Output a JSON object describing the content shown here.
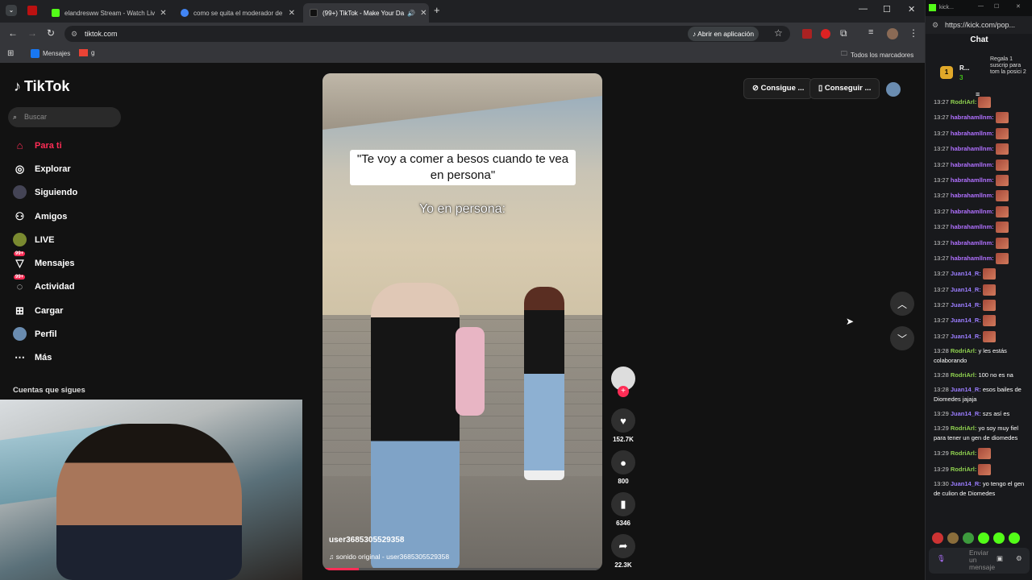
{
  "browser": {
    "tabs": [
      {
        "title": "elandresww Stream - Watch Liv",
        "color": "#53fc18",
        "active": false
      },
      {
        "title": "como se quita el moderador de",
        "color": "#4285f4",
        "active": false
      },
      {
        "title": "(99+) TikTok - Make Your Da",
        "color": "#000000",
        "active": true
      }
    ],
    "url": "tiktok.com",
    "open_app_label": "Abrir en aplicación",
    "bookmarks": [
      {
        "label": "Mensajes"
      },
      {
        "label": "g"
      }
    ],
    "all_bookmarks_label": "Todos los marcadores"
  },
  "tiktok": {
    "logo": "TikTok",
    "search_placeholder": "Buscar",
    "nav": [
      {
        "label": "Para ti",
        "icon": "home-icon"
      },
      {
        "label": "Explorar",
        "icon": "compass-icon"
      },
      {
        "label": "Siguiendo",
        "icon": "following-icon"
      },
      {
        "label": "Amigos",
        "icon": "friends-icon"
      },
      {
        "label": "LIVE",
        "icon": "live-icon"
      },
      {
        "label": "Mensajes",
        "icon": "messages-icon",
        "badge": "99+"
      },
      {
        "label": "Actividad",
        "icon": "activity-icon",
        "badge": "99+"
      },
      {
        "label": "Cargar",
        "icon": "upload-icon"
      },
      {
        "label": "Perfil",
        "icon": "profile-icon"
      },
      {
        "label": "Más",
        "icon": "more-icon"
      }
    ],
    "following_heading": "Cuentas que sigues",
    "top_buttons": [
      "Consigue ...",
      "Conseguir ..."
    ],
    "video": {
      "caption_top": "\"Te voy a comer a besos cuando te vea en persona\"",
      "caption_bottom": "Yo en persona:",
      "username": "user3685305529358",
      "sound": "sonido original - user3685305529358",
      "progress": 0.13
    },
    "actions": {
      "likes": "152.7K",
      "comments": "800",
      "saves": "6346",
      "shares": "22.3K"
    }
  },
  "kick": {
    "tab_title": "kick...",
    "url": "https://kick.com/pop...",
    "chat_title": "Chat",
    "leader": {
      "rank": "1",
      "name": "R...",
      "count": "3"
    },
    "promo": "Regala 1 suscrip para tom la posici 2",
    "messages": [
      {
        "time": "13:27",
        "user": "RodriArl",
        "text": "",
        "color": "#8fd14f",
        "emote": true
      },
      {
        "time": "13:27",
        "user": "habrahamllnm",
        "text": "",
        "color": "#b070ff",
        "emote": true
      },
      {
        "time": "13:27",
        "user": "habrahamllnm",
        "text": "",
        "color": "#b070ff",
        "emote": true
      },
      {
        "time": "13:27",
        "user": "habrahamllnm",
        "text": "",
        "color": "#b070ff",
        "emote": true
      },
      {
        "time": "13:27",
        "user": "habrahamllnm",
        "text": "",
        "color": "#b070ff",
        "emote": true
      },
      {
        "time": "13:27",
        "user": "habrahamllnm",
        "text": "",
        "color": "#b070ff",
        "emote": true
      },
      {
        "time": "13:27",
        "user": "habrahamllnm",
        "text": "",
        "color": "#b070ff",
        "emote": true
      },
      {
        "time": "13:27",
        "user": "habrahamllnm",
        "text": "",
        "color": "#b070ff",
        "emote": true
      },
      {
        "time": "13:27",
        "user": "habrahamllnm",
        "text": "",
        "color": "#b070ff",
        "emote": true
      },
      {
        "time": "13:27",
        "user": "habrahamllnm",
        "text": "",
        "color": "#b070ff",
        "emote": true
      },
      {
        "time": "13:27",
        "user": "habrahamllnm",
        "text": "",
        "color": "#b070ff",
        "emote": true
      },
      {
        "time": "13:27",
        "user": "Juan14_R",
        "text": "",
        "color": "#9b7dff",
        "emote": true
      },
      {
        "time": "13:27",
        "user": "Juan14_R",
        "text": "",
        "color": "#9b7dff",
        "emote": true
      },
      {
        "time": "13:27",
        "user": "Juan14_R",
        "text": "",
        "color": "#9b7dff",
        "emote": true
      },
      {
        "time": "13:27",
        "user": "Juan14_R",
        "text": "",
        "color": "#9b7dff",
        "emote": true
      },
      {
        "time": "13:27",
        "user": "Juan14_R",
        "text": "",
        "color": "#9b7dff",
        "emote": true
      },
      {
        "time": "13:28",
        "user": "RodriArl",
        "text": "y les estás colaborando",
        "color": "#8fd14f",
        "emote": false
      },
      {
        "time": "13:28",
        "user": "RodriArl",
        "text": "100 no es na",
        "color": "#8fd14f",
        "emote": false
      },
      {
        "time": "13:28",
        "user": "Juan14_R",
        "text": "esos bailes de Diomedes jajaja",
        "color": "#9b7dff",
        "emote": false
      },
      {
        "time": "13:29",
        "user": "Juan14_R",
        "text": "szs así es",
        "color": "#9b7dff",
        "emote": false
      },
      {
        "time": "13:29",
        "user": "RodriArl",
        "text": "yo soy muy fiel para tener un gen de diomedes",
        "color": "#8fd14f",
        "emote": false
      },
      {
        "time": "13:29",
        "user": "RodriArl",
        "text": "",
        "color": "#8fd14f",
        "emote": true
      },
      {
        "time": "13:29",
        "user": "RodriArl",
        "text": "",
        "color": "#8fd14f",
        "emote": true
      },
      {
        "time": "13:30",
        "user": "Juan14_R",
        "text": "yo tengo el gen de culion de Diomedes",
        "color": "#9b7dff",
        "emote": false
      }
    ],
    "input_placeholder": "Enviar un mensaje"
  }
}
